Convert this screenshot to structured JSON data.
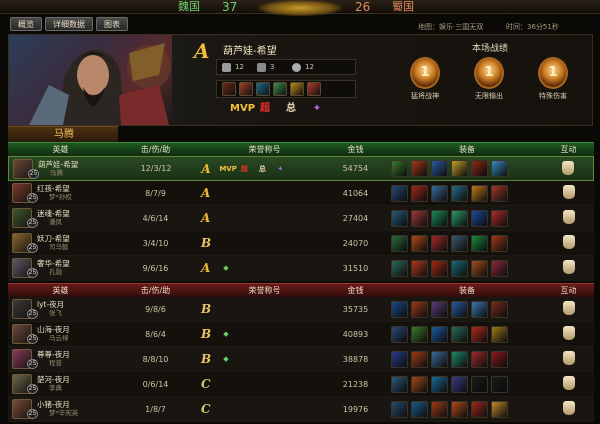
{
  "scorebar": {
    "team_left": "魏国",
    "score_left": "37",
    "team_right": "蜀国",
    "score_right": "26"
  },
  "tabs": [
    "概览",
    "详细数据",
    "图表"
  ],
  "info": {
    "map": "地图：娱乐·三国无双",
    "time": "时间：36分51秒"
  },
  "featured": {
    "grade": "A",
    "title": "葫芦娃-希望",
    "kills": "12",
    "deaths": "3",
    "assists": "12",
    "selected_name": "马腾",
    "honors": [
      {
        "icon": "mvp-honor-icon",
        "glyph": "MVP",
        "color": "#f2c13a"
      },
      {
        "icon": "chaoshen-honor-icon",
        "glyph": "超",
        "color": "#e8312a"
      },
      {
        "icon": "zong-honor-icon",
        "glyph": "总",
        "color": "#e8d8b0"
      },
      {
        "icon": "purple-honor-icon",
        "glyph": "✦",
        "color": "#b06ae8"
      }
    ],
    "equip_colors": [
      "#6a2a14",
      "#a04020",
      "#1a6a8a",
      "#3a8a4a",
      "#c08a1a",
      "#b03a2a"
    ]
  },
  "record": {
    "title": "本场战绩",
    "medals": [
      {
        "rank": "1",
        "label": "猛将战神"
      },
      {
        "rank": "1",
        "label": "无限输出"
      },
      {
        "rank": "1",
        "label": "特殊伤害"
      }
    ]
  },
  "headers": {
    "hero": "英雄",
    "kda": "击/伤/助",
    "honor": "荣誉称号",
    "gold": "金钱",
    "equip": "装备",
    "act": "互动"
  },
  "green_team": [
    {
      "hero": "葫芦娃-希望",
      "player": "马腾",
      "level": "25",
      "kda": "12/3/12",
      "grade": "A",
      "gold": "54754",
      "avatar": "#6a4a3a",
      "honors": [
        "MVP",
        "超",
        "总",
        "✦"
      ],
      "equip": [
        "#3a7a2a",
        "#a03a1a",
        "#2a5aa0",
        "#c0a02a",
        "#8a2a1a",
        "#3a8ac0"
      ]
    },
    {
      "hero": "红孩-希望",
      "player": "梦*孙权",
      "level": "25",
      "kda": "8/7/9",
      "grade": "A",
      "gold": "41064",
      "avatar": "#7a3a2a",
      "honors": [],
      "equip": [
        "#2a4a7a",
        "#a02a1a",
        "#3a6a9a",
        "#2a6a8a",
        "#c07a1a",
        "#a03a2a"
      ]
    },
    {
      "hero": "迷魂-希望",
      "player": "潘凤",
      "level": "25",
      "kda": "4/6/14",
      "grade": "A",
      "gold": "27404",
      "avatar": "#3a5a2a",
      "honors": [],
      "equip": [
        "#2a5a7a",
        "#a03a3a",
        "#1a8a5a",
        "#2a9a6a",
        "#1a4a9a",
        "#b02a2a"
      ]
    },
    {
      "hero": "妖刀-希望",
      "player": "司马懿",
      "level": "25",
      "kda": "3/4/10",
      "grade": "B",
      "gold": "24070",
      "avatar": "#8a6a2a",
      "honors": [],
      "equip": [
        "#2a6a3a",
        "#b04a1a",
        "#a02a2a",
        "#3a5a6a",
        "#1a8a3a",
        "#a03a1a"
      ]
    },
    {
      "hero": "奢华-希望",
      "player": "孔融",
      "level": "25",
      "kda": "9/6/16",
      "grade": "A",
      "gold": "31510",
      "avatar": "#5a5a6a",
      "honors": [
        "◆"
      ],
      "equip": [
        "#2a6a5a",
        "#b03a1a",
        "#a02a1a",
        "#1a6a7a",
        "#a0501a",
        "#8a2a3a"
      ]
    }
  ],
  "red_team": [
    {
      "hero": "lyt-夜月",
      "player": "张飞",
      "level": "25",
      "kda": "9/8/6",
      "grade": "B",
      "gold": "35735",
      "avatar": "#3a3a3a",
      "honors": [],
      "equip": [
        "#1a4a8a",
        "#a03a1a",
        "#5a3a7a",
        "#2a5aa0",
        "#3a7ab0",
        "#7a2a1a"
      ]
    },
    {
      "hero": "山海-夜月",
      "player": "马云禄",
      "level": "25",
      "kda": "8/6/4",
      "grade": "B",
      "gold": "40893",
      "avatar": "#6a4a3a",
      "honors": [
        "◆"
      ],
      "equip": [
        "#2a4a7a",
        "#3a7a2a",
        "#1a5aa0",
        "#2a6a5a",
        "#b02a1a",
        "#a07a1a"
      ]
    },
    {
      "hero": "尊尊-夜月",
      "player": "程普",
      "level": "25",
      "kda": "8/8/10",
      "grade": "B",
      "gold": "38878",
      "avatar": "#8a3a5a",
      "honors": [
        "◆"
      ],
      "equip": [
        "#2a3a8a",
        "#a03a1a",
        "#3a6a9a",
        "#1a8a6a",
        "#a02a2a",
        "#8a1a1a"
      ]
    },
    {
      "hero": "楚河-夜月",
      "player": "李典",
      "level": "25",
      "kda": "0/6/14",
      "grade": "C",
      "gold": "21238",
      "avatar": "#6a6a4a",
      "honors": [],
      "equip": [
        "#2a5a7a",
        "#a04a1a",
        "#1a6a9a",
        "#3a3a8a",
        "#1a1a1a",
        "#1a1a1a"
      ]
    },
    {
      "hero": "小猪-夜月",
      "player": "梦*辛宪英",
      "level": "25",
      "kda": "1/8/7",
      "grade": "C",
      "gold": "19976",
      "avatar": "#7a4a3a",
      "honors": [],
      "equip": [
        "#2a4a6a",
        "#1a5a8a",
        "#a03a1a",
        "#b04a1a",
        "#a02a1a",
        "#c08a2a"
      ]
    }
  ]
}
